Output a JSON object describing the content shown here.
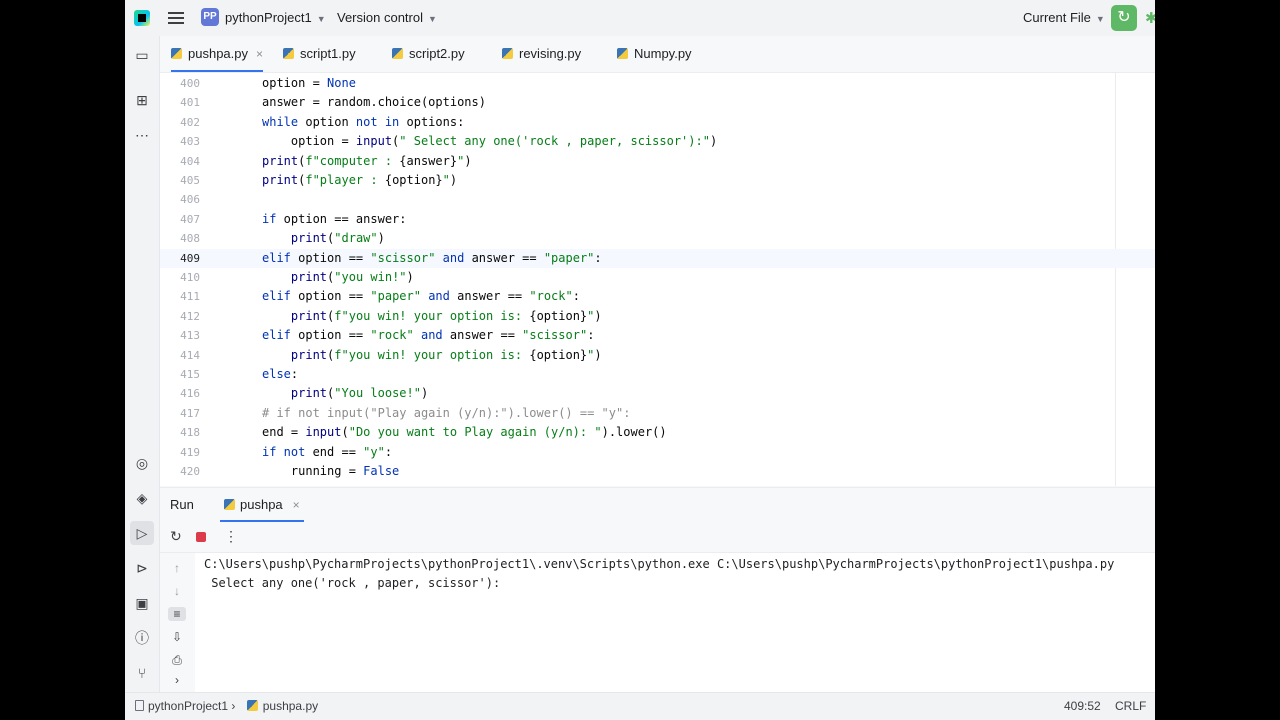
{
  "titlebar": {
    "project_badge": "PP",
    "project_name": "pythonProject1",
    "vcs_label": "Version control",
    "run_config": "Current File"
  },
  "editor_tabs": [
    {
      "label": "pushpa.py",
      "active": true
    },
    {
      "label": "script1.py"
    },
    {
      "label": "script2.py"
    },
    {
      "label": "revising.py"
    },
    {
      "label": "Numpy.py"
    }
  ],
  "editor": {
    "current_line": 409,
    "line_numbers": [
      "400",
      "401",
      "402",
      "403",
      "404",
      "405",
      "406",
      "407",
      "408",
      "409",
      "410",
      "411",
      "412",
      "413",
      "414",
      "415",
      "416",
      "417",
      "418",
      "419",
      "420"
    ]
  },
  "run_panel": {
    "title": "Run",
    "tab_label": "pushpa",
    "console_lines": [
      "C:\\Users\\pushp\\PycharmProjects\\pythonProject1\\.venv\\Scripts\\python.exe C:\\Users\\pushp\\PycharmProjects\\pythonProject1\\pushpa.py",
      " Select any one('rock , paper, scissor'):"
    ]
  },
  "statusbar": {
    "crumb_project": "pythonProject1",
    "crumb_file": "pushpa.py",
    "caret_position": "409:52",
    "line_separator": "CRLF"
  },
  "icons": {
    "app": "pycharm-logo-icon",
    "menu": "hamburger-menu-icon",
    "run": "run-icon",
    "debug": "debug-icon"
  },
  "colors": {
    "accent": "#3574f0",
    "run_green": "#5fb865",
    "stop_red": "#db3b4b",
    "keyword": "#0033b3",
    "string": "#067d17"
  }
}
